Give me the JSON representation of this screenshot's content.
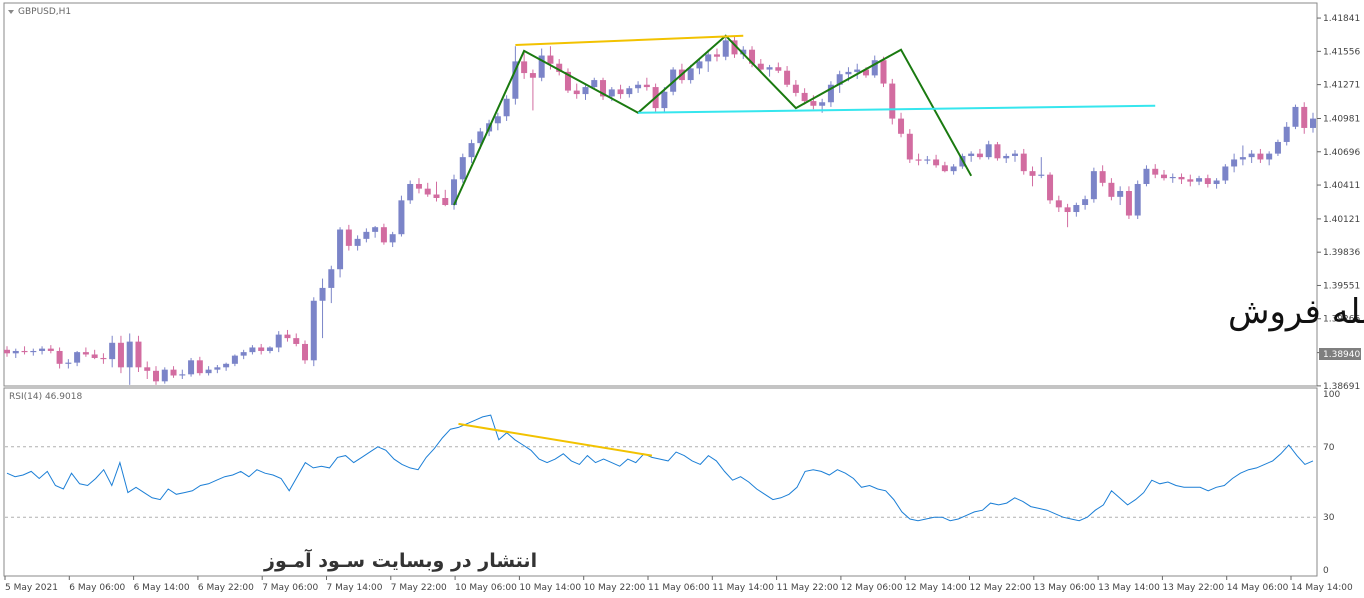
{
  "chart_data": [
    {
      "type": "candlestick",
      "title": "GBPUSD,H1",
      "ylim": [
        1.3869,
        1.4197
      ],
      "y_ticks": [
        "1.41841",
        "1.41556",
        "1.41271",
        "1.40981",
        "1.40696",
        "1.40411",
        "1.40121",
        "1.39836",
        "1.39551",
        "1.39266",
        "1.38976",
        "1.38691"
      ],
      "current_price": "1.38940",
      "colors": {
        "bull": "#7b84c8",
        "bear": "#d26ca0"
      },
      "candles": [
        [
          1.39,
          1.3903,
          1.3894,
          1.3897
        ],
        [
          1.3897,
          1.3901,
          1.3893,
          1.3899
        ],
        [
          1.3899,
          1.3903,
          1.3896,
          1.3898
        ],
        [
          1.3898,
          1.3901,
          1.3895,
          1.3899
        ],
        [
          1.3899,
          1.3903,
          1.3896,
          1.3901
        ],
        [
          1.3901,
          1.3904,
          1.3897,
          1.3899
        ],
        [
          1.3899,
          1.3902,
          1.3884,
          1.3888
        ],
        [
          1.3888,
          1.3892,
          1.3884,
          1.3889
        ],
        [
          1.3889,
          1.3899,
          1.3886,
          1.3898
        ],
        [
          1.3898,
          1.3902,
          1.3894,
          1.3896
        ],
        [
          1.3896,
          1.39,
          1.3892,
          1.3893
        ],
        [
          1.3893,
          1.3897,
          1.3888,
          1.3892
        ],
        [
          1.3892,
          1.3912,
          1.3885,
          1.3906
        ],
        [
          1.3906,
          1.3912,
          1.388,
          1.3885
        ],
        [
          1.3885,
          1.3914,
          1.387,
          1.3907
        ],
        [
          1.3907,
          1.3912,
          1.3881,
          1.3885
        ],
        [
          1.3885,
          1.389,
          1.3875,
          1.3882
        ],
        [
          1.3882,
          1.3886,
          1.387,
          1.3873
        ],
        [
          1.3873,
          1.3885,
          1.3871,
          1.3883
        ],
        [
          1.3883,
          1.3886,
          1.3876,
          1.3878
        ],
        [
          1.3878,
          1.3883,
          1.3875,
          1.3879
        ],
        [
          1.3879,
          1.3893,
          1.3877,
          1.3891
        ],
        [
          1.3891,
          1.3894,
          1.3878,
          1.388
        ],
        [
          1.388,
          1.3886,
          1.3878,
          1.3883
        ],
        [
          1.3883,
          1.3887,
          1.388,
          1.3885
        ],
        [
          1.3885,
          1.3889,
          1.3882,
          1.3888
        ],
        [
          1.3888,
          1.3896,
          1.3886,
          1.3895
        ],
        [
          1.3895,
          1.39,
          1.3892,
          1.3898
        ],
        [
          1.3898,
          1.3904,
          1.3896,
          1.3902
        ],
        [
          1.3902,
          1.3905,
          1.3896,
          1.3899
        ],
        [
          1.3899,
          1.3903,
          1.3897,
          1.3902
        ],
        [
          1.3902,
          1.3916,
          1.3898,
          1.3913
        ],
        [
          1.3913,
          1.3917,
          1.3907,
          1.391
        ],
        [
          1.391,
          1.3914,
          1.3903,
          1.3905
        ],
        [
          1.3905,
          1.3908,
          1.3888,
          1.3891
        ],
        [
          1.3891,
          1.3945,
          1.3886,
          1.3942
        ],
        [
          1.3942,
          1.3961,
          1.391,
          1.3953
        ],
        [
          1.3953,
          1.3972,
          1.394,
          1.3969
        ],
        [
          1.3969,
          1.4005,
          1.3962,
          1.4003
        ],
        [
          1.4003,
          1.4007,
          1.3985,
          1.3989
        ],
        [
          1.3989,
          1.3998,
          1.3985,
          1.3995
        ],
        [
          1.3995,
          1.4004,
          1.3992,
          1.4001
        ],
        [
          1.4001,
          1.4006,
          1.3996,
          1.4005
        ],
        [
          1.4005,
          1.4008,
          1.399,
          1.3992
        ],
        [
          1.3992,
          1.4001,
          1.3988,
          1.3999
        ],
        [
          1.3999,
          1.4032,
          1.3997,
          1.4028
        ],
        [
          1.4028,
          1.4045,
          1.4025,
          1.4042
        ],
        [
          1.4042,
          1.4047,
          1.4034,
          1.4038
        ],
        [
          1.4038,
          1.4043,
          1.4031,
          1.4033
        ],
        [
          1.4033,
          1.4044,
          1.4027,
          1.403
        ],
        [
          1.403,
          1.4037,
          1.4023,
          1.4024
        ],
        [
          1.4024,
          1.405,
          1.402,
          1.4046
        ],
        [
          1.4046,
          1.4068,
          1.4043,
          1.4065
        ],
        [
          1.4065,
          1.408,
          1.406,
          1.4077
        ],
        [
          1.4077,
          1.409,
          1.4072,
          1.4087
        ],
        [
          1.4087,
          1.4097,
          1.4083,
          1.4094
        ],
        [
          1.4094,
          1.4103,
          1.4088,
          1.41
        ],
        [
          1.41,
          1.4118,
          1.4096,
          1.4115
        ],
        [
          1.4115,
          1.416,
          1.411,
          1.4147
        ],
        [
          1.4147,
          1.4155,
          1.4132,
          1.4137
        ],
        [
          1.4137,
          1.414,
          1.4105,
          1.4133
        ],
        [
          1.4133,
          1.4158,
          1.413,
          1.4152
        ],
        [
          1.4152,
          1.416,
          1.414,
          1.4145
        ],
        [
          1.4145,
          1.4149,
          1.4135,
          1.4138
        ],
        [
          1.4138,
          1.4141,
          1.412,
          1.4122
        ],
        [
          1.4122,
          1.4128,
          1.4115,
          1.4119
        ],
        [
          1.4119,
          1.4127,
          1.4114,
          1.4125
        ],
        [
          1.4125,
          1.4133,
          1.4124,
          1.4131
        ],
        [
          1.4131,
          1.4133,
          1.4114,
          1.4117
        ],
        [
          1.4117,
          1.4125,
          1.4113,
          1.4123
        ],
        [
          1.4123,
          1.4127,
          1.4115,
          1.4119
        ],
        [
          1.4119,
          1.4126,
          1.4116,
          1.4124
        ],
        [
          1.4124,
          1.413,
          1.412,
          1.4127
        ],
        [
          1.4127,
          1.4133,
          1.4122,
          1.4125
        ],
        [
          1.4125,
          1.4128,
          1.4103,
          1.4107
        ],
        [
          1.4107,
          1.4125,
          1.4104,
          1.4121
        ],
        [
          1.4121,
          1.4142,
          1.4118,
          1.414
        ],
        [
          1.414,
          1.4145,
          1.4128,
          1.4131
        ],
        [
          1.4131,
          1.4144,
          1.4128,
          1.4141
        ],
        [
          1.4141,
          1.415,
          1.4136,
          1.4147
        ],
        [
          1.4147,
          1.4157,
          1.4138,
          1.4153
        ],
        [
          1.4153,
          1.4158,
          1.4147,
          1.4151
        ],
        [
          1.4151,
          1.4169,
          1.4148,
          1.4165
        ],
        [
          1.4165,
          1.4168,
          1.415,
          1.4153
        ],
        [
          1.4153,
          1.416,
          1.4149,
          1.4157
        ],
        [
          1.4157,
          1.416,
          1.4142,
          1.4145
        ],
        [
          1.4145,
          1.4149,
          1.4137,
          1.414
        ],
        [
          1.414,
          1.4144,
          1.4134,
          1.4142
        ],
        [
          1.4142,
          1.4146,
          1.4137,
          1.4139
        ],
        [
          1.4139,
          1.4143,
          1.4125,
          1.4127
        ],
        [
          1.4127,
          1.4131,
          1.4117,
          1.412
        ],
        [
          1.412,
          1.4124,
          1.411,
          1.4113
        ],
        [
          1.4113,
          1.4118,
          1.4106,
          1.4109
        ],
        [
          1.4109,
          1.4115,
          1.4103,
          1.4112
        ],
        [
          1.4112,
          1.413,
          1.4108,
          1.4127
        ],
        [
          1.4127,
          1.4139,
          1.412,
          1.4136
        ],
        [
          1.4136,
          1.4142,
          1.413,
          1.4138
        ],
        [
          1.4138,
          1.4145,
          1.4132,
          1.414
        ],
        [
          1.414,
          1.4142,
          1.4133,
          1.4135
        ],
        [
          1.4135,
          1.4152,
          1.4133,
          1.4148
        ],
        [
          1.4148,
          1.4151,
          1.4125,
          1.4128
        ],
        [
          1.4128,
          1.4132,
          1.4093,
          1.4098
        ],
        [
          1.4098,
          1.4103,
          1.4082,
          1.4085
        ],
        [
          1.4085,
          1.4089,
          1.406,
          1.4063
        ],
        [
          1.4063,
          1.4068,
          1.4058,
          1.4062
        ],
        [
          1.4062,
          1.4066,
          1.4059,
          1.4063
        ],
        [
          1.4063,
          1.4067,
          1.4056,
          1.4058
        ],
        [
          1.4058,
          1.4061,
          1.4052,
          1.4053
        ],
        [
          1.4053,
          1.4059,
          1.405,
          1.4057
        ],
        [
          1.4057,
          1.4068,
          1.4055,
          1.4066
        ],
        [
          1.4066,
          1.407,
          1.4061,
          1.4068
        ],
        [
          1.4068,
          1.4072,
          1.4063,
          1.4065
        ],
        [
          1.4065,
          1.4079,
          1.4063,
          1.4076
        ],
        [
          1.4076,
          1.4078,
          1.4062,
          1.4064
        ],
        [
          1.4064,
          1.4068,
          1.406,
          1.4066
        ],
        [
          1.4066,
          1.4071,
          1.4061,
          1.4068
        ],
        [
          1.4068,
          1.4072,
          1.405,
          1.4053
        ],
        [
          1.4053,
          1.4057,
          1.404,
          1.4049
        ],
        [
          1.4049,
          1.4065,
          1.4047,
          1.405
        ],
        [
          1.405,
          1.4052,
          1.4025,
          1.4028
        ],
        [
          1.4028,
          1.4032,
          1.4018,
          1.4022
        ],
        [
          1.4022,
          1.4025,
          1.4005,
          1.4018
        ],
        [
          1.4018,
          1.4026,
          1.4014,
          1.4024
        ],
        [
          1.4024,
          1.4032,
          1.402,
          1.4029
        ],
        [
          1.4029,
          1.4056,
          1.4026,
          1.4053
        ],
        [
          1.4053,
          1.4058,
          1.404,
          1.4043
        ],
        [
          1.4043,
          1.4047,
          1.4028,
          1.4031
        ],
        [
          1.4031,
          1.404,
          1.4024,
          1.4036
        ],
        [
          1.4036,
          1.404,
          1.4012,
          1.4015
        ],
        [
          1.4015,
          1.4045,
          1.4012,
          1.4042
        ],
        [
          1.4042,
          1.4058,
          1.404,
          1.4055
        ],
        [
          1.4055,
          1.4059,
          1.4047,
          1.405
        ],
        [
          1.405,
          1.4054,
          1.4045,
          1.4047
        ],
        [
          1.4047,
          1.4051,
          1.4043,
          1.4048
        ],
        [
          1.4048,
          1.4051,
          1.4042,
          1.4046
        ],
        [
          1.4046,
          1.405,
          1.404,
          1.4044
        ],
        [
          1.4044,
          1.4049,
          1.4041,
          1.4047
        ],
        [
          1.4047,
          1.405,
          1.4039,
          1.4042
        ],
        [
          1.4042,
          1.4047,
          1.4038,
          1.4045
        ],
        [
          1.4045,
          1.4059,
          1.4042,
          1.4057
        ],
        [
          1.4057,
          1.4068,
          1.4052,
          1.4063
        ],
        [
          1.4063,
          1.4075,
          1.4058,
          1.4065
        ],
        [
          1.4065,
          1.4071,
          1.406,
          1.4068
        ],
        [
          1.4068,
          1.4072,
          1.406,
          1.4063
        ],
        [
          1.4063,
          1.407,
          1.4058,
          1.4068
        ],
        [
          1.4068,
          1.408,
          1.4066,
          1.4078
        ],
        [
          1.4078,
          1.4095,
          1.4075,
          1.4091
        ],
        [
          1.4091,
          1.411,
          1.4089,
          1.4108
        ],
        [
          1.4108,
          1.4112,
          1.4085,
          1.409
        ],
        [
          1.409,
          1.4103,
          1.4086,
          1.4098
        ]
      ]
    },
    {
      "type": "line",
      "title": "RSI(14) 46.9018",
      "ylim": [
        0,
        100
      ],
      "y_ticks": [
        "100",
        "70",
        "30",
        "0"
      ],
      "levels": [
        70,
        30
      ],
      "x_ticks": [
        "5 May 2021",
        "6 May 06:00",
        "6 May 14:00",
        "6 May 22:00",
        "7 May 06:00",
        "7 May 14:00",
        "7 May 22:00",
        "10 May 06:00",
        "10 May 14:00",
        "10 May 22:00",
        "11 May 06:00",
        "11 May 14:00",
        "11 May 22:00",
        "12 May 06:00",
        "12 May 14:00",
        "12 May 22:00",
        "13 May 06:00",
        "13 May 14:00",
        "13 May 22:00",
        "14 May 06:00",
        "14 May 14:00"
      ],
      "color": "#1c7fd6",
      "values": [
        55,
        53,
        54,
        56,
        52,
        56,
        48,
        46,
        55,
        49,
        48,
        52,
        57,
        48,
        61,
        44,
        47,
        44,
        41,
        40,
        46,
        43,
        44,
        45,
        48,
        49,
        51,
        53,
        54,
        56,
        53,
        57,
        55,
        54,
        52,
        45,
        53,
        61,
        58,
        59,
        58,
        64,
        65,
        61,
        64,
        67,
        70,
        68,
        63,
        60,
        58,
        57,
        64,
        69,
        75,
        80,
        81,
        83,
        85,
        87,
        88,
        74,
        78,
        74,
        71,
        68,
        63,
        61,
        63,
        66,
        62,
        60,
        65,
        61,
        63,
        61,
        59,
        63,
        61,
        66,
        64,
        63,
        62,
        67,
        65,
        62,
        60,
        65,
        62,
        56,
        51,
        53,
        50,
        46,
        43,
        40,
        41,
        43,
        47,
        56,
        57,
        56,
        54,
        57,
        55,
        52,
        47,
        48,
        46,
        45,
        40,
        33,
        29,
        28,
        29,
        30,
        30,
        28,
        29,
        31,
        33,
        34,
        38,
        37,
        38,
        41,
        39,
        36,
        35,
        34,
        32,
        30,
        29,
        28,
        30,
        34,
        37,
        45,
        41,
        37,
        40,
        44,
        51,
        49,
        50,
        48,
        47,
        47,
        47,
        45,
        47,
        48,
        52,
        55,
        57,
        58,
        60,
        62,
        66,
        71,
        65,
        60,
        62
      ],
      "x_index_range": [
        0,
        163
      ]
    }
  ],
  "annotations": {
    "sell_caption": "معامله فروش",
    "watermark": "انتشار در وبسایت سـود آمـوز"
  }
}
